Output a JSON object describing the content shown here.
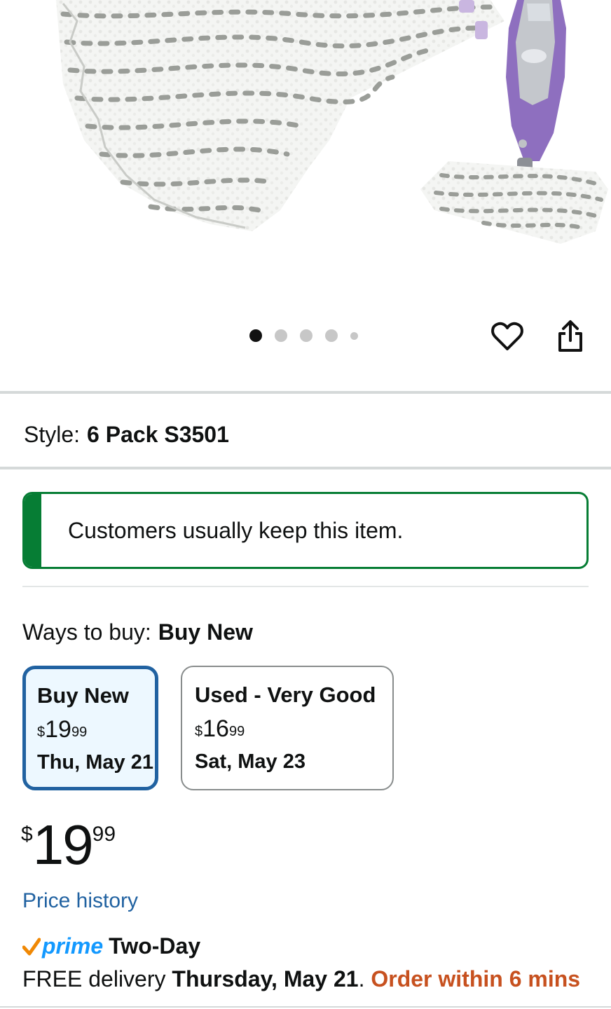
{
  "gallery": {
    "image_alt": "Steam mop pads 6 pack with steam mop",
    "dot_count": 5,
    "active_dot": 1
  },
  "actions": {
    "wishlist_icon": "heart-outline-icon",
    "share_icon": "share-icon"
  },
  "style": {
    "label": "Style:",
    "value": "6 Pack S3501"
  },
  "keep_banner": {
    "text": "Customers usually keep this item.",
    "accent_color": "#067d34"
  },
  "ways_to_buy": {
    "label": "Ways to buy:",
    "selected": "Buy New",
    "options": [
      {
        "title": "Buy New",
        "currency": "$",
        "whole": "19",
        "fraction": "99",
        "date": "Thu, May 21",
        "selected": true
      },
      {
        "title": "Used - Very Good",
        "currency": "$",
        "whole": "16",
        "fraction": "99",
        "date": "Sat, May 23",
        "selected": false
      }
    ]
  },
  "price": {
    "currency": "$",
    "whole": "19",
    "fraction": "99"
  },
  "price_history": {
    "label": "Price history",
    "color": "#2162a1"
  },
  "prime": {
    "logo_text": "prime",
    "speed": "Two-Day",
    "logo_color": "#1399ff"
  },
  "delivery": {
    "prefix": "FREE delivery",
    "date": "Thursday, May 21",
    "sep": ".",
    "order_cutoff": "Order within 6 mins",
    "order_color": "#c7511f"
  }
}
